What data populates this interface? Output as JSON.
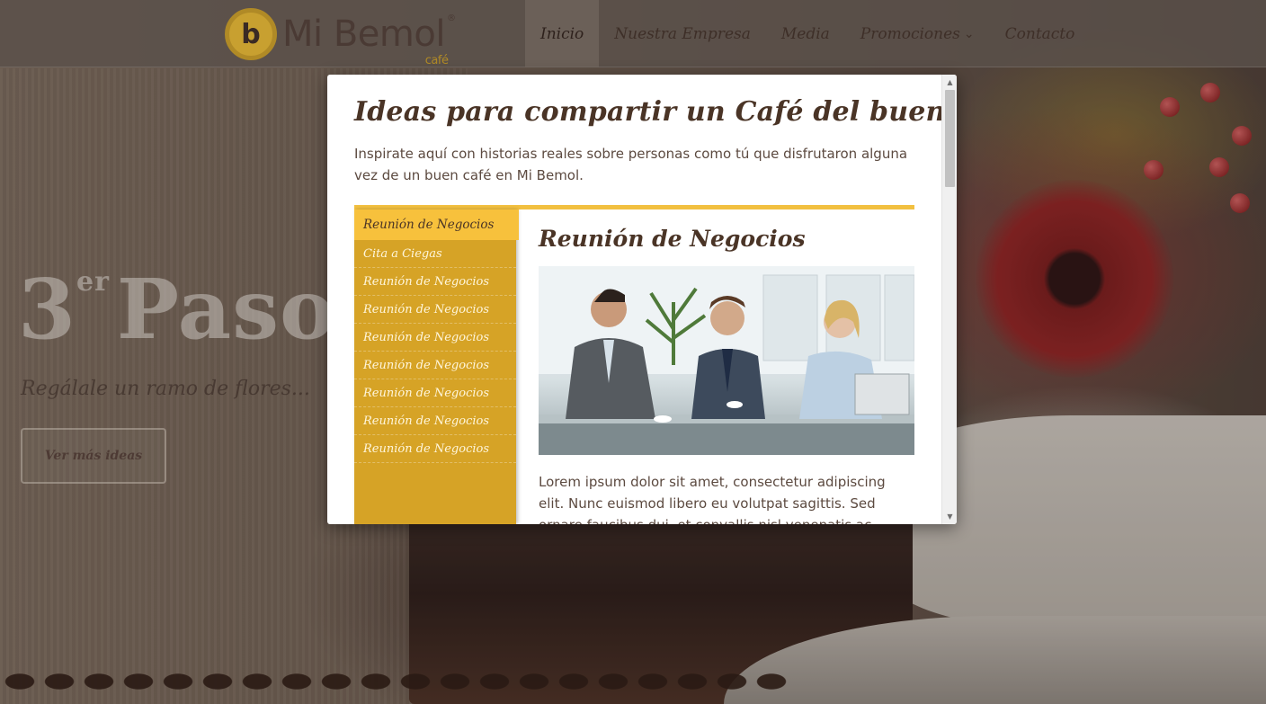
{
  "header": {
    "logo": {
      "brand": "Mi Bemol",
      "sub": "café",
      "registered": "®",
      "mark": "b"
    },
    "nav": [
      {
        "label": "Inicio",
        "active": true
      },
      {
        "label": "Nuestra Empresa",
        "active": false
      },
      {
        "label": "Media",
        "active": false
      },
      {
        "label": "Promociones",
        "active": false,
        "has_dropdown": true
      },
      {
        "label": "Contacto",
        "active": false
      }
    ]
  },
  "hero": {
    "step_number": "3",
    "step_sup": "er",
    "step_word": "Paso",
    "subtitle": "Regálale un ramo de flores...",
    "button_label": "Ver más ideas"
  },
  "modal": {
    "title": "Ideas para compartir un Café del bueno.",
    "intro": "Inspirate aquí con historias reales sobre personas como tú que disfrutaron alguna vez de un buen café en Mi Bemol.",
    "sidebar": [
      {
        "label": "Reunión de Negocios",
        "active": true
      },
      {
        "label": "Cita a Ciegas",
        "active": false
      },
      {
        "label": "Reunión de Negocios",
        "active": false
      },
      {
        "label": "Reunión de Negocios",
        "active": false
      },
      {
        "label": "Reunión de Negocios",
        "active": false
      },
      {
        "label": "Reunión de Negocios",
        "active": false
      },
      {
        "label": "Reunión de Negocios",
        "active": false
      },
      {
        "label": "Reunión de Negocios",
        "active": false
      },
      {
        "label": "Reunión de Negocios",
        "active": false
      }
    ],
    "content": {
      "title": "Reunión de Negocios",
      "body": "Lorem ipsum dolor sit amet, consectetur adipiscing elit. Nunc euismod libero eu volutpat sagittis. Sed ornare faucibus dui, et convallis nisl venenatis ac. Lorem ipsum"
    }
  },
  "colors": {
    "accent": "#f2c040",
    "sidebar": "#d6a326",
    "title_text": "#4a3426",
    "body_text": "#5c4a40"
  },
  "icons": {
    "nav_dropdown": "chevron-down-icon",
    "scroll_up": "scroll-up-arrow-icon",
    "scroll_down": "scroll-down-arrow-icon"
  }
}
